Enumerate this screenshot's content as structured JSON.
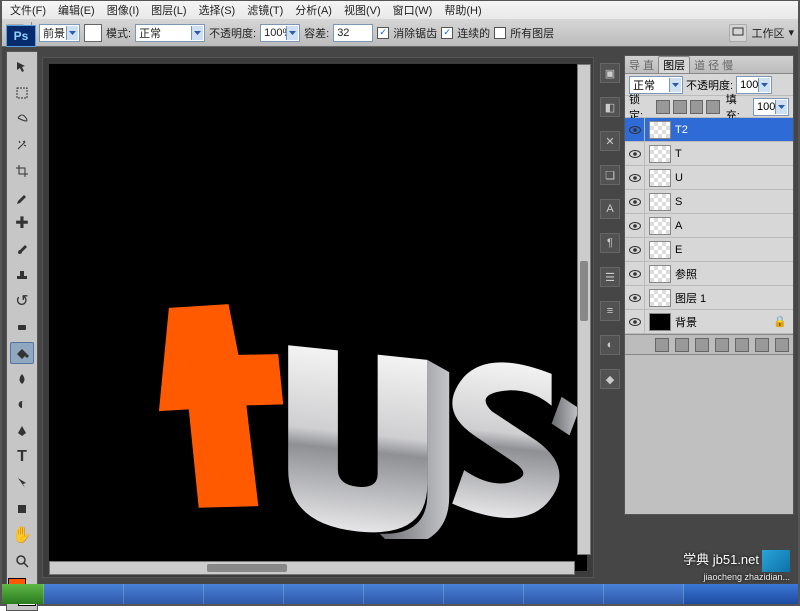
{
  "menu": {
    "items": [
      "文件(F)",
      "编辑(E)",
      "图像(I)",
      "图层(L)",
      "选择(S)",
      "滤镜(T)",
      "分析(A)",
      "视图(V)",
      "窗口(W)",
      "帮助(H)"
    ]
  },
  "optionbar": {
    "fill_label": "前景",
    "mode_label": "模式:",
    "mode_value": "正常",
    "opacity_label": "不透明度:",
    "opacity_value": "100%",
    "tolerance_label": "容差:",
    "tolerance_value": "32",
    "antialias": "消除锯齿",
    "contiguous": "连续的",
    "all_layers": "所有图层",
    "workspace": "工作区"
  },
  "ps_logo": "Ps",
  "toolbox": {
    "tools": [
      "move",
      "marquee",
      "lasso",
      "wand",
      "crop",
      "eyedropper",
      "patch",
      "brush",
      "stamp",
      "history",
      "eraser",
      "gradient",
      "blur",
      "dodge",
      "pen",
      "type",
      "path",
      "rect",
      "notes",
      "hand",
      "zoom"
    ],
    "foreground": "#ff5a00",
    "background": "#ffffff"
  },
  "layers_panel": {
    "tabs": [
      "导 直",
      "图层",
      "道 径 慢"
    ],
    "active_tab": 1,
    "blend_mode": "正常",
    "opacity_label": "不透明度:",
    "opacity_value": "100%",
    "lock_label": "锁定:",
    "fill_label": "填充:",
    "fill_value": "100%",
    "layers": [
      {
        "name": "T2",
        "selected": true,
        "thumb": "checker"
      },
      {
        "name": "T",
        "thumb": "checker"
      },
      {
        "name": "U",
        "thumb": "checker"
      },
      {
        "name": "S",
        "thumb": "checker"
      },
      {
        "name": "A",
        "thumb": "checker"
      },
      {
        "name": "E",
        "thumb": "checker"
      },
      {
        "name": "参照",
        "thumb": "checker"
      },
      {
        "name": "图层 1",
        "thumb": "checker"
      },
      {
        "name": "背景",
        "thumb": "black",
        "locked": true
      }
    ]
  },
  "watermark": {
    "text": "学典 jb51.net",
    "sub": "jiaocheng zhazidian..."
  },
  "canvas_art": "tuse"
}
